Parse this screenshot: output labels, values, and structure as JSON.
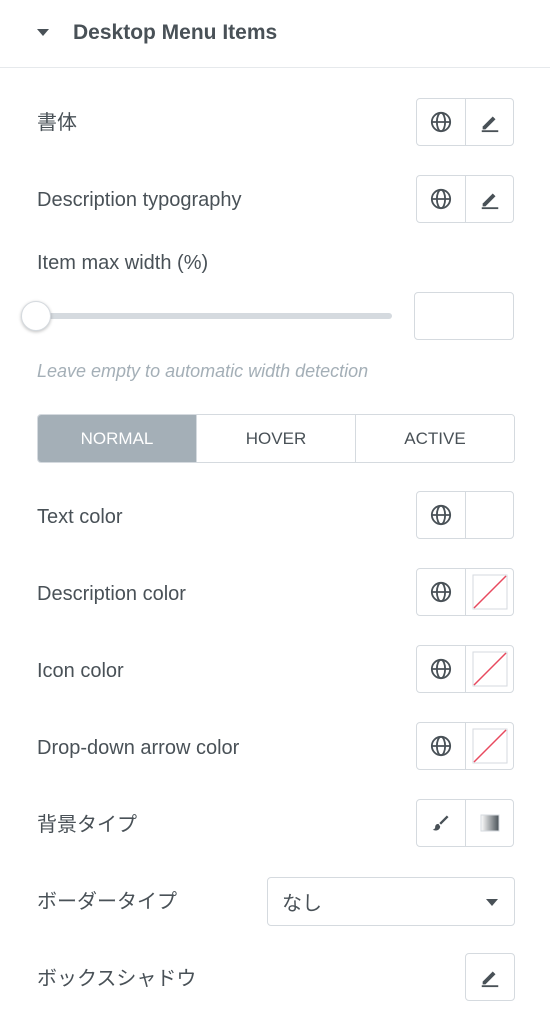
{
  "section": {
    "title": "Desktop Menu Items"
  },
  "controls": {
    "typography": {
      "label": "書体"
    },
    "description_typography": {
      "label": "Description typography"
    },
    "item_max_width": {
      "label": "Item max width (%)",
      "value": "",
      "hint": "Leave empty to automatic width detection"
    },
    "tabs": [
      {
        "label": "NORMAL",
        "active": true
      },
      {
        "label": "HOVER",
        "active": false
      },
      {
        "label": "ACTIVE",
        "active": false
      }
    ],
    "text_color": {
      "label": "Text color"
    },
    "description_color": {
      "label": "Description color"
    },
    "icon_color": {
      "label": "Icon color"
    },
    "dropdown_arrow_color": {
      "label": "Drop-down arrow color"
    },
    "background_type": {
      "label": "背景タイプ"
    },
    "border_type": {
      "label": "ボーダータイプ",
      "selected": "なし"
    },
    "box_shadow": {
      "label": "ボックスシャドウ"
    }
  },
  "colors": {
    "text": "#495157",
    "border": "#d5dadf",
    "active_tab": "#a4afb7",
    "hint": "#a4afb7",
    "no_color_slash": "#e84a5f"
  },
  "icons": [
    "caret-down-icon",
    "globe-icon",
    "pencil-icon",
    "brush-icon",
    "gradient-icon",
    "chevron-down-icon"
  ]
}
